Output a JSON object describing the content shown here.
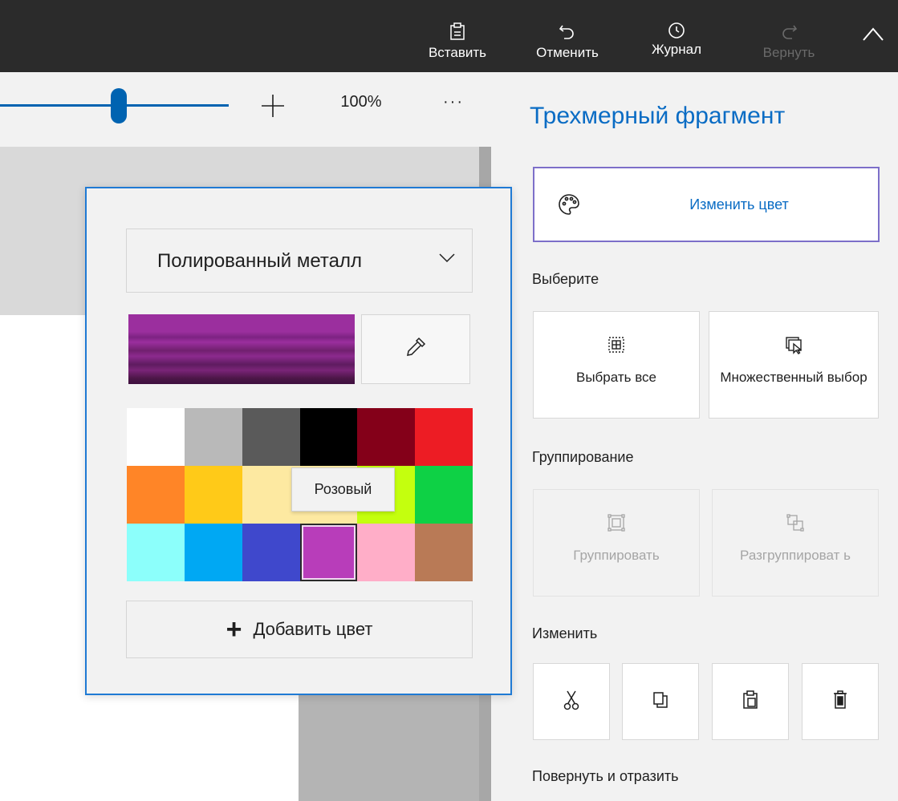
{
  "toolbar": {
    "paste_label": "Вставить",
    "undo_label": "Отменить",
    "history_label": "Журнал",
    "redo_label": "Вернуть"
  },
  "zoom": {
    "value": "100%",
    "slider_level": 0.5,
    "more_label": "···"
  },
  "side_panel": {
    "title": "Трехмерный фрагмент",
    "change_color_label": "Изменить цвет",
    "select_section": "Выберите",
    "select_all_label": "Выбрать все",
    "multi_select_label": "Множественный выбор",
    "group_section": "Группирование",
    "group_label": "Группировать",
    "ungroup_label": "Разгруппироват ь",
    "edit_section": "Изменить",
    "rotate_section": "Повернуть и отразить"
  },
  "color_picker": {
    "material": "Полированный металл",
    "preview_color": "#9b2f9e",
    "tooltip": "Розовый",
    "add_color_label": "Добавить цвет",
    "swatches": [
      "#ffffff",
      "#b9b9b9",
      "#5a5a5a",
      "#000000",
      "#840019",
      "#ed1c24",
      "#ff8527",
      "#ffca18",
      "#fde9a1",
      "#fde9a1",
      "#c4ff0e",
      "#0ed145",
      "#8cfffb",
      "#00a8f3",
      "#3f48cc",
      "#b83dba",
      "#ffaec8",
      "#b97a56"
    ],
    "selected_swatch_index": 15
  },
  "colors": {
    "accent": "#0a6cc4",
    "topbar": "#2b2b2b",
    "panel": "#f2f2f2"
  }
}
